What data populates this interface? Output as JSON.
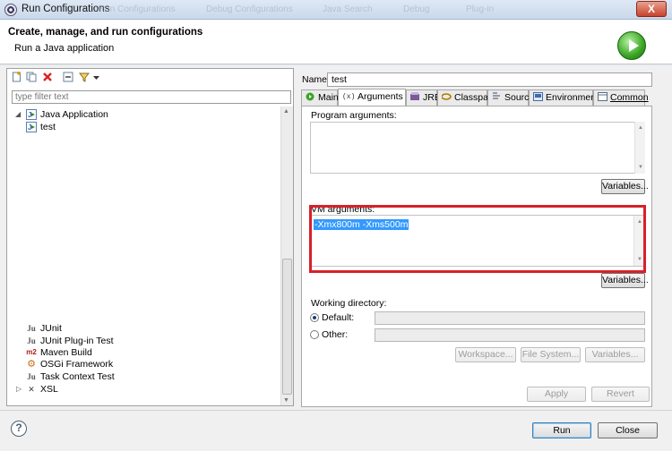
{
  "window": {
    "title": "Run Configurations",
    "close_label": "X",
    "background_tabs": [
      "Run Configurations",
      "Debug Configurations",
      "Java Search",
      "Debug",
      "Plug-in"
    ]
  },
  "header": {
    "title": "Create, manage, and run configurations",
    "subtitle": "Run a Java application",
    "icon": "run-green-icon"
  },
  "left": {
    "toolbar_icons": [
      "new-config-icon",
      "duplicate-icon",
      "delete-icon",
      "collapse-all-icon",
      "filter-icon",
      "view-menu-icon"
    ],
    "filter_placeholder": "type filter text",
    "tree": [
      {
        "label": "Java Application",
        "expanded": true,
        "icon": "java-app-icon"
      },
      {
        "label": "test",
        "child": true,
        "icon": "java-app-icon"
      },
      {
        "label": "JUnit",
        "icon": "junit-icon",
        "glyph": "Ju"
      },
      {
        "label": "JUnit Plug-in Test",
        "icon": "junit-plugin-icon",
        "glyph": "Ju"
      },
      {
        "label": "Maven Build",
        "icon": "maven-icon",
        "glyph": "m2"
      },
      {
        "label": "OSGi Framework",
        "icon": "osgi-icon",
        "glyph": "⚙"
      },
      {
        "label": "Task Context Test",
        "icon": "task-context-icon",
        "glyph": "Ju"
      },
      {
        "label": "XSL",
        "collapsed": true,
        "icon": "xsl-icon",
        "glyph": "✕"
      }
    ]
  },
  "right": {
    "name_label": "Name:",
    "name_value": "test",
    "tabs": [
      "Main",
      "Arguments",
      "JRE",
      "Classpath",
      "Source",
      "Environment",
      "Common"
    ],
    "active_tab": "Arguments",
    "program_args_label": "Program arguments:",
    "program_args_value": "",
    "variables_label": "Variables...",
    "vm_args_label": "VM arguments:",
    "vm_args_value": "-Xmx800m -Xms500m",
    "vm_variables_label": "Variables...",
    "working_dir_label": "Working directory:",
    "default_label": "Default:",
    "default_value": "",
    "other_label": "Other:",
    "other_value": "",
    "workspace_label": "Workspace...",
    "filesystem_label": "File System...",
    "wd_variables_label": "Variables...",
    "apply_label": "Apply",
    "revert_label": "Revert"
  },
  "footer": {
    "help": "?",
    "run_label": "Run",
    "close_label": "Close"
  },
  "colors": {
    "highlight": "#d9202a",
    "selection": "#3399ff"
  }
}
